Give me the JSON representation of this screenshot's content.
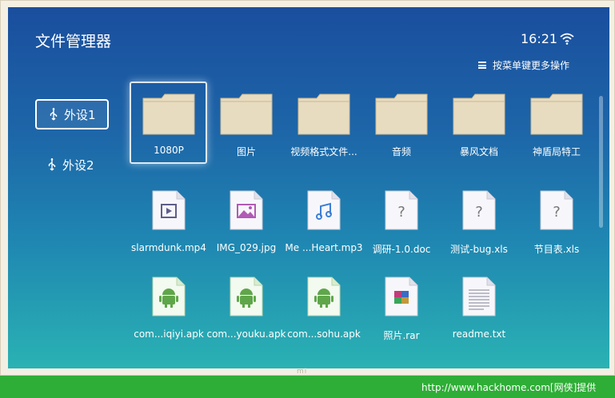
{
  "app": {
    "title": "文件管理器",
    "time": "16:21"
  },
  "menu_hint": {
    "text": "按菜单键更多操作",
    "icon": "menu-icon"
  },
  "devices": [
    {
      "label": "外设1",
      "selected": true
    },
    {
      "label": "外设2",
      "selected": false
    }
  ],
  "files": [
    {
      "name": "1080P",
      "type": "folder",
      "selected": true
    },
    {
      "name": "图片",
      "type": "folder"
    },
    {
      "name": "视频格式文件...",
      "type": "folder"
    },
    {
      "name": "音频",
      "type": "folder"
    },
    {
      "name": "暴风文档",
      "type": "folder"
    },
    {
      "name": "神盾局特工",
      "type": "folder"
    },
    {
      "name": "slarmdunk.mp4",
      "type": "video"
    },
    {
      "name": "IMG_029.jpg",
      "type": "image"
    },
    {
      "name": "Me ...Heart.mp3",
      "type": "audio"
    },
    {
      "name": "调研-1.0.doc",
      "type": "unknown"
    },
    {
      "name": "测试-bug.xls",
      "type": "unknown"
    },
    {
      "name": "节目表.xls",
      "type": "unknown"
    },
    {
      "name": "com...iqiyi.apk",
      "type": "apk"
    },
    {
      "name": "com...youku.apk",
      "type": "apk"
    },
    {
      "name": "com...sohu.apk",
      "type": "apk"
    },
    {
      "name": "照片.rar",
      "type": "archive"
    },
    {
      "name": "readme.txt",
      "type": "text"
    }
  ],
  "bezel_logo": "mi",
  "footer": {
    "text": "http://www.hackhome.com[网侠]提供"
  },
  "colors": {
    "folder": "#e8dcc0",
    "apk": "#5fa64a",
    "doc_bg": "#f7f7fb",
    "footer": "#2eae36"
  }
}
